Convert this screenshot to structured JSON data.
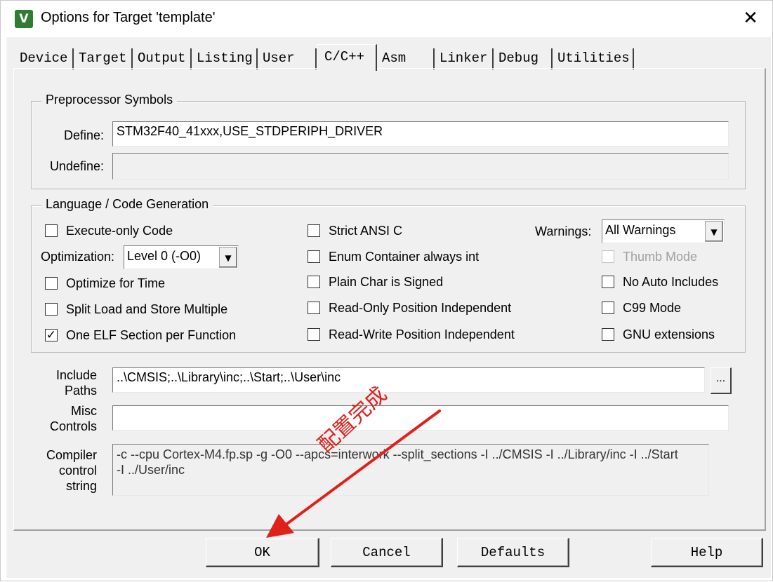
{
  "window": {
    "title": "Options for Target 'template'",
    "icon_label": "V",
    "close_glyph": "✕"
  },
  "tabs": [
    {
      "label": "Device"
    },
    {
      "label": "Target"
    },
    {
      "label": "Output"
    },
    {
      "label": "Listing"
    },
    {
      "label": "User"
    },
    {
      "label": "C/C++",
      "active": true
    },
    {
      "label": "Asm"
    },
    {
      "label": "Linker"
    },
    {
      "label": "Debug"
    },
    {
      "label": "Utilities"
    }
  ],
  "preprocessor": {
    "group_title": "Preprocessor Symbols",
    "define_label": "Define:",
    "define_value": "STM32F40_41xxx,USE_STDPERIPH_DRIVER",
    "undefine_label": "Undefine:",
    "undefine_value": ""
  },
  "language": {
    "group_title": "Language / Code Generation",
    "execute_only": {
      "label": "Execute-only Code",
      "checked": false
    },
    "optimization_label": "Optimization:",
    "optimization_value": "Level 0 (-O0)",
    "optimize_time": {
      "label": "Optimize for Time",
      "checked": false
    },
    "split_load": {
      "label": "Split Load and Store Multiple",
      "checked": false
    },
    "one_elf": {
      "label": "One ELF Section per Function",
      "checked": true
    },
    "strict_ansi": {
      "label": "Strict ANSI C",
      "checked": false
    },
    "enum_container": {
      "label": "Enum Container always int",
      "checked": false
    },
    "plain_char": {
      "label": "Plain Char is Signed",
      "checked": false
    },
    "ro_position": {
      "label": "Read-Only Position Independent",
      "checked": false
    },
    "rw_position": {
      "label": "Read-Write Position Independent",
      "checked": false
    },
    "warnings_label": "Warnings:",
    "warnings_value": "All Warnings",
    "thumb_mode": {
      "label": "Thumb Mode",
      "checked": false,
      "disabled": true
    },
    "no_auto_includes": {
      "label": "No Auto Includes",
      "checked": false
    },
    "c99_mode": {
      "label": "C99 Mode",
      "checked": false
    },
    "gnu_extensions": {
      "label": "GNU extensions",
      "checked": false
    }
  },
  "paths": {
    "include_label_1": "Include",
    "include_label_2": "Paths",
    "include_value": "..\\CMSIS;..\\Library\\inc;..\\Start;..\\User\\inc",
    "browse_label": "...",
    "misc_label_1": "Misc",
    "misc_label_2": "Controls",
    "misc_value": "",
    "compiler_label_1": "Compiler",
    "compiler_label_2": "control",
    "compiler_label_3": "string",
    "compiler_value": "-c --cpu Cortex-M4.fp.sp -g -O0 --apcs=interwork --split_sections -I ../CMSIS -I ../Library/inc -I ../Start -I ../User/inc"
  },
  "buttons": {
    "ok": "OK",
    "cancel": "Cancel",
    "defaults": "Defaults",
    "help": "Help"
  },
  "annotation": {
    "text": "配置完成",
    "color": "#e0201a"
  },
  "colors": {
    "dialog_bg": "#f0f0f0",
    "icon_green": "#2e7d32",
    "annotation_red": "#e0201a"
  }
}
